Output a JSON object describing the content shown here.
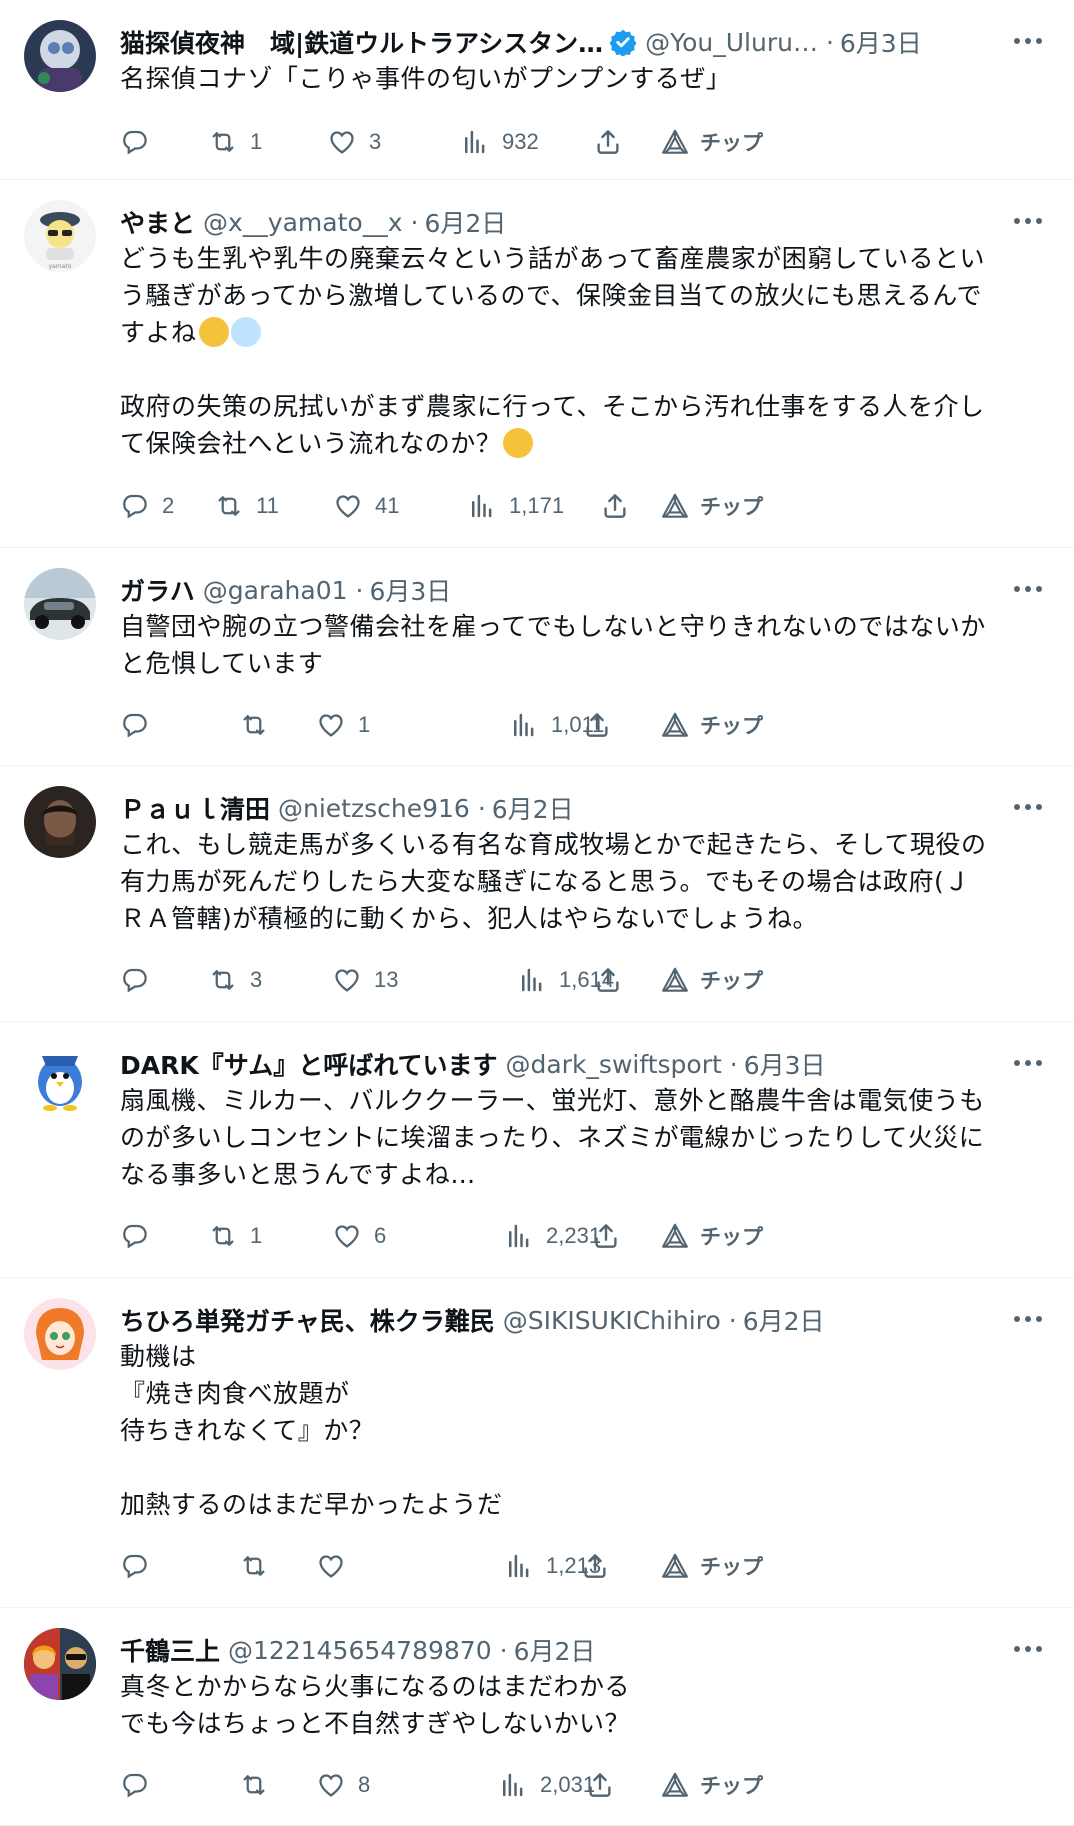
{
  "tweets": [
    {
      "name": "猫探偵夜神　域|鉄道ウルトラアシスタン…",
      "verified": true,
      "handle": "@You_Uluru…",
      "date": "6月3日",
      "lines": [
        "名探偵コナゾ「こりゃ事件の匂いがプンプンするぜ」"
      ],
      "replies": "",
      "retweets": "1",
      "likes": "3",
      "views": "932",
      "tip_label": "チップ"
    },
    {
      "name": "やまと",
      "verified": false,
      "handle": "@x__yamato__x",
      "date": "6月2日",
      "lines": [
        "どうも生乳や乳牛の廃棄云々という話があって畜産農家が困窮しているとい",
        "う騒ぎがあってから激増しているので、保険金目当ての放火にも思えるんで",
        "すよね",
        "",
        "政府の失策の尻拭いがまず農家に行って、そこから汚れ仕事をする人を介し",
        "て保険会社へという流れなのか？"
      ],
      "replies": "2",
      "retweets": "11",
      "likes": "41",
      "views": "1,171",
      "tip_label": "チップ"
    },
    {
      "name": "ガラハ",
      "verified": false,
      "handle": "@garaha01",
      "date": "6月3日",
      "lines": [
        "自警団や腕の立つ警備会社を雇ってでもしないと守りきれないのではないか",
        "と危惧しています"
      ],
      "replies": "",
      "retweets": "",
      "likes": "1",
      "views": "1,011",
      "tip_label": "チップ"
    },
    {
      "name": "Ｐａｕｌ清田",
      "verified": false,
      "handle": "@nietzsche916",
      "date": "6月2日",
      "lines": [
        "これ、もし競走馬が多くいる有名な育成牧場とかで起きたら、そして現役の",
        "有力馬が死んだりしたら大変な騒ぎになると思う。でもその場合は政府(Ｊ",
        "ＲＡ管轄)が積極的に動くから、犯人はやらないでしょうね。"
      ],
      "replies": "",
      "retweets": "3",
      "likes": "13",
      "views": "1,614",
      "tip_label": "チップ"
    },
    {
      "name": "DARK『サム』と呼ばれています",
      "verified": false,
      "handle": "@dark_swiftsport",
      "date": "6月3日",
      "lines": [
        "扇風機、ミルカー、バルククーラー、蛍光灯、意外と酪農牛舎は電気使うも",
        "のが多いしコンセントに埃溜まったり、ネズミが電線かじったりして火災に",
        "なる事多いと思うんですよね…"
      ],
      "replies": "",
      "retweets": "1",
      "likes": "6",
      "views": "2,231",
      "tip_label": "チップ"
    },
    {
      "name": "ちひろ単発ガチャ民、株クラ難民",
      "verified": false,
      "handle": "@SIKISUKIChihiro",
      "date": "6月2日",
      "lines": [
        "動機は",
        "『焼き肉食べ放題が",
        "待ちきれなくて』か？",
        "",
        "加熱するのはまだ早かったようだ"
      ],
      "replies": "",
      "retweets": "",
      "likes": "",
      "views": "1,213",
      "tip_label": "チップ"
    },
    {
      "name": "千鶴三上",
      "verified": false,
      "handle": "@122145654789870",
      "date": "6月2日",
      "lines": [
        "真冬とかからなら火事になるのはまだわかる",
        "でも今はちょっと不自然すぎやしないかい？"
      ],
      "replies": "",
      "retweets": "",
      "likes": "8",
      "views": "2,031",
      "tip_label": "チップ"
    }
  ],
  "colors": {
    "text": "#0f1419",
    "muted": "#536471",
    "verified": "#1d9bf0",
    "divider": "#eff3f4"
  },
  "icons": [
    "reply-icon",
    "retweet-icon",
    "like-icon",
    "views-icon",
    "share-icon",
    "tip-icon",
    "more-icon",
    "verified-icon"
  ]
}
